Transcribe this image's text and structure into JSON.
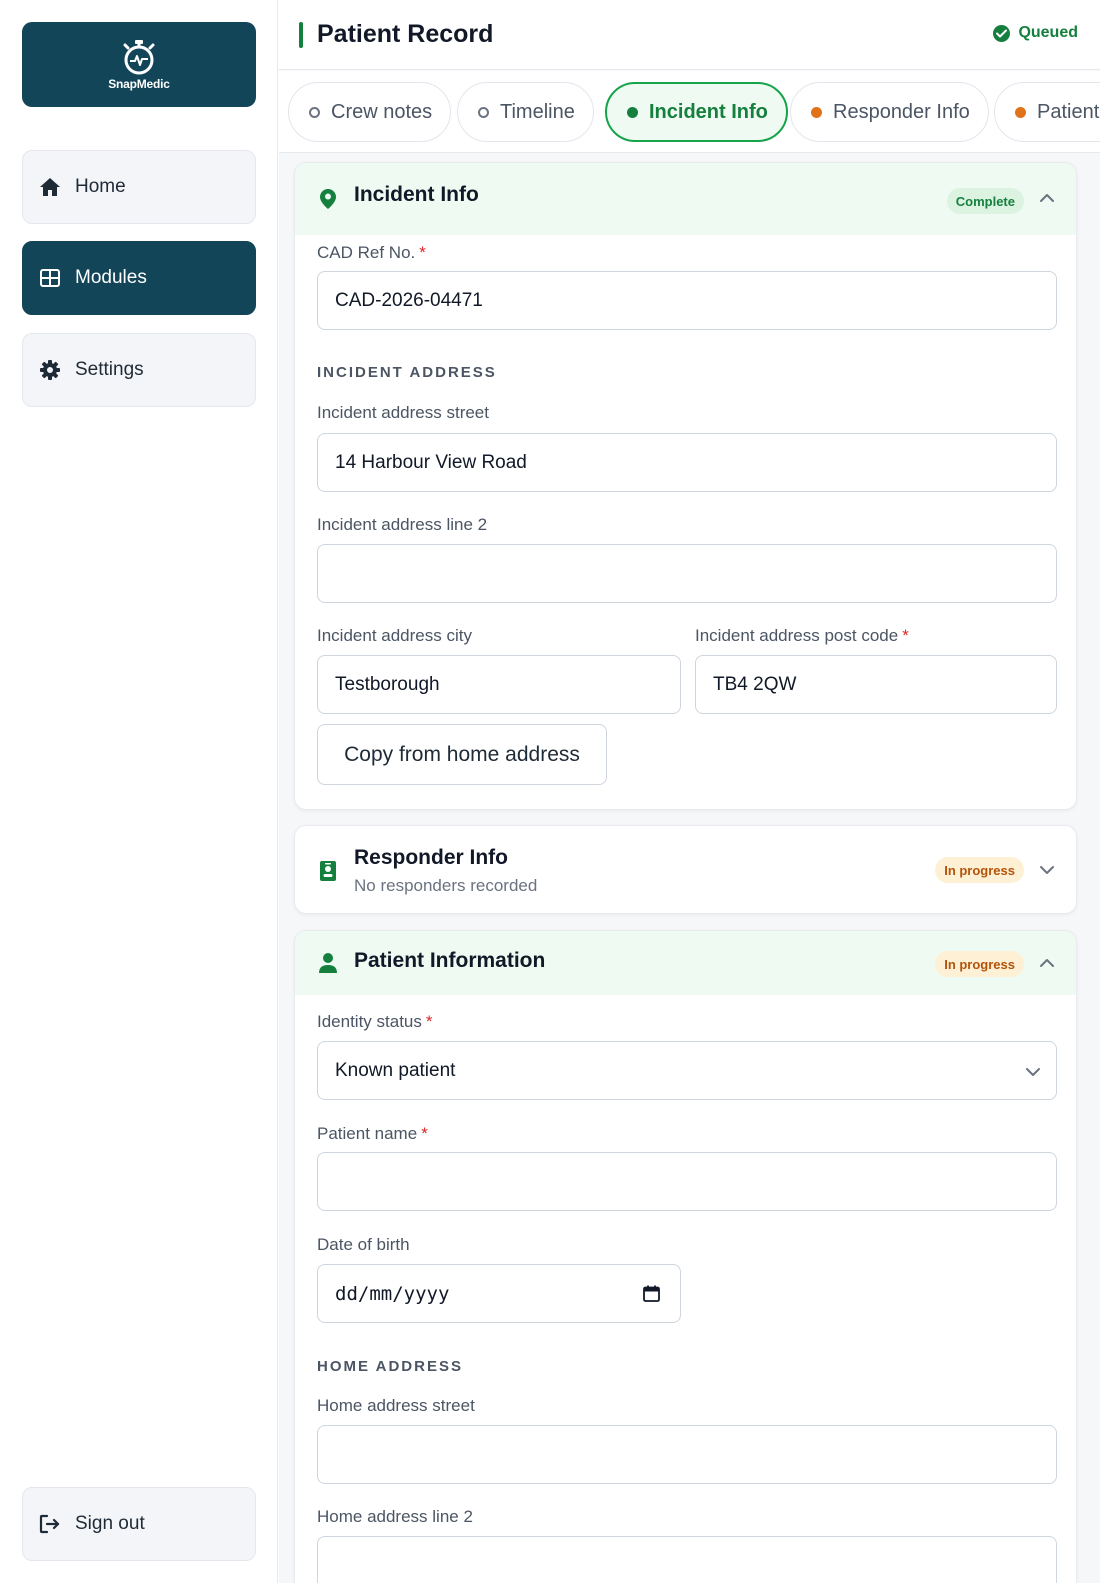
{
  "app": {
    "logo_text": "SnapMedic"
  },
  "sidebar": {
    "items": [
      {
        "label": "Home"
      },
      {
        "label": "Modules"
      },
      {
        "label": "Settings"
      }
    ],
    "sign_out_label": "Sign out"
  },
  "header": {
    "title": "Patient Record",
    "sync_status": "Queued"
  },
  "tabs": [
    {
      "label": "Crew notes",
      "state": "empty"
    },
    {
      "label": "Timeline",
      "state": "empty"
    },
    {
      "label": "Incident Info",
      "state": "complete"
    },
    {
      "label": "Responder Info",
      "state": "in-progress"
    },
    {
      "label": "Patient",
      "state": "in-progress"
    }
  ],
  "incident": {
    "title": "Incident Info",
    "badge": "Complete",
    "cad_label": "CAD Ref No.",
    "cad_value": "CAD-2026-04471",
    "address_section": "INCIDENT ADDRESS",
    "street_label": "Incident address street",
    "street_value": "14 Harbour View Road",
    "line2_label": "Incident address line 2",
    "line2_value": "",
    "city_label": "Incident address city",
    "city_value": "Testborough",
    "postcode_label": "Incident address post code",
    "postcode_value": "TB4 2QW",
    "copy_button": "Copy from home address"
  },
  "responder": {
    "title": "Responder Info",
    "subtitle": "No responders recorded",
    "badge": "In progress"
  },
  "patient": {
    "title": "Patient Information",
    "badge": "In progress",
    "identity_label": "Identity status",
    "identity_value": "Known patient",
    "name_label": "Patient name",
    "name_value": "",
    "dob_label": "Date of birth",
    "dob_placeholder": "dd/mm/yyyy",
    "home_section": "HOME ADDRESS",
    "home_street_label": "Home address street",
    "home_street_value": "",
    "home_line2_label": "Home address line 2",
    "home_line2_value": ""
  },
  "colors": {
    "brand": "#134559",
    "success": "#15803d",
    "warning": "#b45309",
    "required": "#dc2626"
  },
  "icons": {
    "logo": "stopwatch-heart-icon",
    "home": "home-icon",
    "modules": "grid-icon",
    "settings": "gear-icon",
    "sign_out": "sign-out-icon",
    "incident": "map-pin-icon",
    "responder": "id-badge-icon",
    "patient": "person-icon",
    "calendar": "calendar-icon"
  }
}
